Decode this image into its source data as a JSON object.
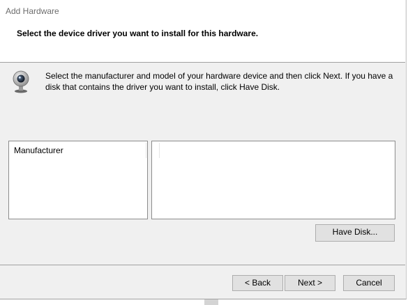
{
  "window": {
    "title": "Add Hardware"
  },
  "header": {
    "heading": "Select the device driver you want to install for this hardware."
  },
  "info": {
    "icon": "webcam-icon",
    "text": "Select the manufacturer and model of your hardware device and then click Next. If you have a disk that contains the driver you want to install, click Have Disk."
  },
  "lists": {
    "manufacturer_header": "Manufacturer",
    "model_header": ""
  },
  "buttons": {
    "have_disk": "Have Disk...",
    "back": "< Back",
    "next": "Next >",
    "cancel": "Cancel"
  }
}
